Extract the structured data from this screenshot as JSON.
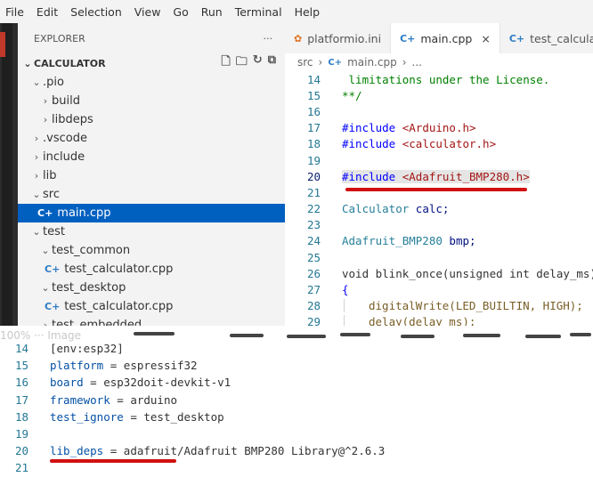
{
  "menu": [
    "File",
    "Edit",
    "Selection",
    "View",
    "Go",
    "Run",
    "Terminal",
    "Help"
  ],
  "explorer": {
    "title": "EXPLORER",
    "more": "···",
    "section": "CALCULATOR",
    "items": [
      {
        "label": ".pio",
        "chev": "⌄"
      },
      {
        "label": "build",
        "chev": "›"
      },
      {
        "label": "libdeps",
        "chev": "›"
      },
      {
        "label": ".vscode",
        "chev": "›"
      },
      {
        "label": "include",
        "chev": "›"
      },
      {
        "label": "lib",
        "chev": "›"
      },
      {
        "label": "src",
        "chev": "⌄"
      },
      {
        "label": "main.cpp",
        "icon": "C+"
      },
      {
        "label": "test",
        "chev": "⌄"
      },
      {
        "label": "test_common",
        "chev": "⌄"
      },
      {
        "label": "test_calculator.cpp",
        "icon": "C+"
      },
      {
        "label": "test_desktop",
        "chev": "⌄"
      },
      {
        "label": "test_calculator.cpp",
        "icon": "C+"
      },
      {
        "label": "test_embedded",
        "chev": "›"
      }
    ]
  },
  "tabs": [
    {
      "label": "platformio.ini",
      "icon": "✿"
    },
    {
      "label": "main.cpp",
      "icon": "C+",
      "close": "×"
    },
    {
      "label": "test_calculato",
      "icon": "C+"
    }
  ],
  "breadcrumb": {
    "folder": "src",
    "sep": "›",
    "file": "main.cpp",
    "tail": "..."
  },
  "code_lines": [
    {
      "n": "14",
      "text": " limitations under the License."
    },
    {
      "n": "15",
      "text": "**/"
    },
    {
      "n": "16",
      "text": ""
    },
    {
      "n": "17",
      "pre": "#include",
      "post": "<Arduino.h>"
    },
    {
      "n": "18",
      "pre": "#include",
      "post": "<calculator.h>"
    },
    {
      "n": "19",
      "text": ""
    },
    {
      "n": "20",
      "pre": "#include",
      "post": "<Adafruit_BMP280.h>"
    },
    {
      "n": "21",
      "text": ""
    },
    {
      "n": "22",
      "type": "Calculator",
      "rest": " calc;"
    },
    {
      "n": "23",
      "text": ""
    },
    {
      "n": "24",
      "type": "Adafruit_BMP280",
      "rest": " bmp;"
    },
    {
      "n": "25",
      "text": ""
    },
    {
      "n": "26",
      "text": "void blink_once(unsigned int delay_ms)"
    },
    {
      "n": "27",
      "text": "{"
    },
    {
      "n": "28",
      "text": "digitalWrite(LED_BUILTIN, HIGH);"
    },
    {
      "n": "29",
      "text": "delay(delay_ms);"
    }
  ],
  "faded_text": "100%      ···  Image",
  "ini_lines": [
    {
      "n": "14",
      "text": "[env:esp32]"
    },
    {
      "n": "15",
      "key": "platform",
      "val": "espressif32"
    },
    {
      "n": "16",
      "key": "board",
      "val": "esp32doit-devkit-v1"
    },
    {
      "n": "17",
      "key": "framework",
      "val": "arduino"
    },
    {
      "n": "18",
      "key": "test_ignore",
      "val": "test_desktop"
    },
    {
      "n": "19",
      "text": ""
    },
    {
      "n": "20",
      "key": "lib_deps",
      "val": "adafruit/Adafruit BMP280 Library@^2.6.3"
    },
    {
      "n": "21",
      "text": ""
    }
  ],
  "colors": {
    "accent_selected": "#0060c0",
    "annotation_red": "#d01010"
  }
}
